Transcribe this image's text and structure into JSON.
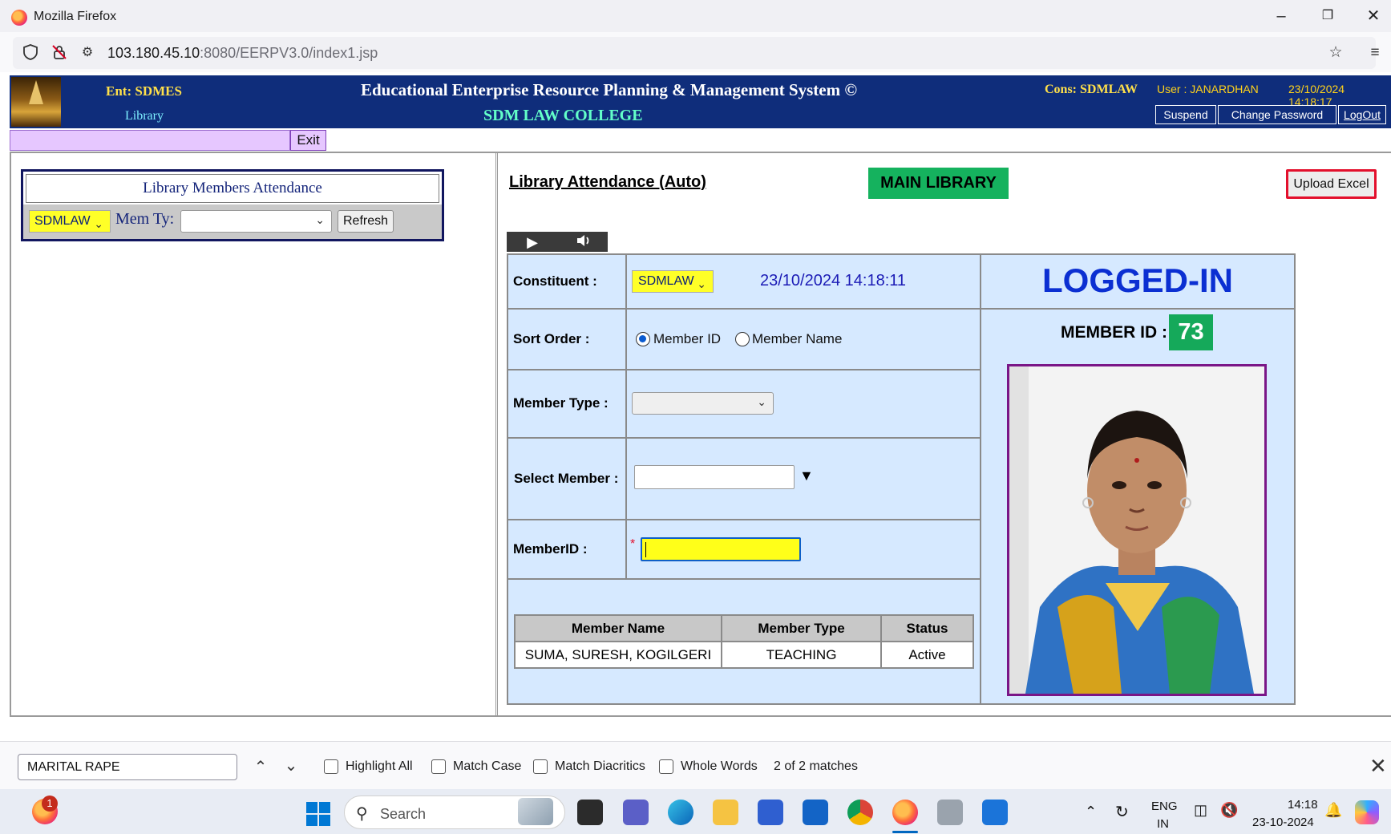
{
  "browser": {
    "window_title": "Mozilla Firefox",
    "url_host": "103.180.45.10",
    "url_path": ":8080/EERPV3.0/index1.jsp"
  },
  "header": {
    "ent": "Ent: SDMES",
    "module": "Library",
    "system_title": "Educational Enterprise Resource Planning & Management System ©",
    "college": "SDM LAW COLLEGE",
    "cons": "Cons: SDMLAW",
    "user": "User : JANARDHAN",
    "datetime": "23/10/2024 14:18:17",
    "buttons": {
      "suspend": "Suspend",
      "change_password": "Change Password",
      "logout": "LogOut"
    }
  },
  "menu": {
    "exit": "Exit"
  },
  "left_panel": {
    "title": "Library Members Attendance",
    "constituent": "SDMLAW",
    "mem_type_label": "Mem Ty:",
    "mem_type_value": "",
    "refresh": "Refresh"
  },
  "attendance": {
    "title": "Library Attendance (Auto)",
    "library": "MAIN LIBRARY",
    "upload": "Upload Excel",
    "constituent_label": "Constituent :",
    "constituent_value": "SDMLAW",
    "datetime": "23/10/2024 14:18:11",
    "sort_order_label": "Sort Order :",
    "sort_options": [
      "Member ID",
      "Member Name"
    ],
    "sort_selected": "Member ID",
    "member_type_label": "Member Type :",
    "select_member_label": "Select Member :",
    "member_id_label": "MemberID :",
    "member_id_value": "",
    "status_text": "LOGGED-IN",
    "member_id_caption": "MEMBER ID :",
    "member_id": "73",
    "table": {
      "headers": [
        "Member Name",
        "Member Type",
        "Status"
      ],
      "rows": [
        [
          "SUMA, SURESH, KOGILGERI",
          "TEACHING",
          "Active"
        ]
      ]
    }
  },
  "findbar": {
    "query": "MARITAL RAPE",
    "options": [
      "Highlight All",
      "Match Case",
      "Match Diacritics",
      "Whole Words"
    ],
    "count": "2 of 2 matches"
  },
  "taskbar": {
    "search_placeholder": "Search",
    "notification_badge": "1",
    "lang": "ENG",
    "region": "IN",
    "time": "14:18",
    "date": "23-10-2024"
  },
  "colors": {
    "header_bg": "#0f2d7b",
    "highlight_yellow": "#ffff27",
    "badge_green": "#15b25e",
    "form_bg": "#d6e9ff",
    "logged_in_blue": "#0b2fd2"
  }
}
